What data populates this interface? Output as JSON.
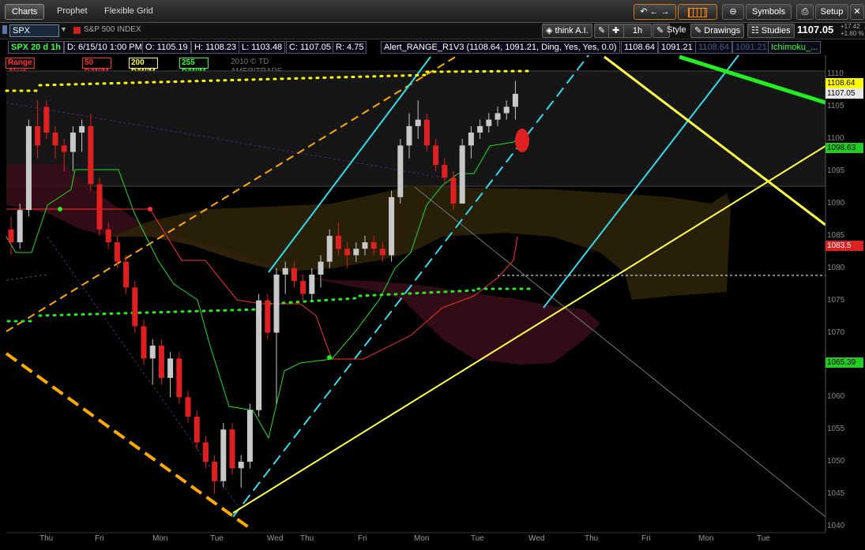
{
  "tabs": [
    {
      "label": "Charts",
      "active": true
    },
    {
      "label": "Prophet",
      "active": false
    },
    {
      "label": "Flexible Grid",
      "active": false
    }
  ],
  "toolbar": {
    "symbols_label": "Symbols",
    "setup_label": "Setup",
    "undo_icon": "undo-icon",
    "back_icon": "back-arrow-icon",
    "forward_icon": "forward-arrow-icon",
    "grid_icon": "grid-layout-icon",
    "minus_icon": "minus-icon",
    "print_icon": "print-icon"
  },
  "symbol_bar": {
    "symbol": "SPX",
    "description": "S&P 500 INDEX",
    "think_ai": "think A.I.",
    "aggregation": "1h",
    "style_label": "Style",
    "drawings_label": "Drawings",
    "studies_label": "Studies",
    "last_price": "1107.05",
    "change": "+17.42",
    "change_pct": "+1.60 %"
  },
  "info_bar": {
    "period": "SPX 20 d 1h",
    "date": "D: 6/15/10 1:00 PM",
    "open": "O: 1105.19",
    "high": "H: 1108.23",
    "low": "L: 1103.48",
    "close": "C: 1107.05",
    "range": "R: 4.75",
    "alert": "Alert_RANGE_R1V3 (1108.64, 1091.21, Ding, Yes, Yes, 0.0)",
    "alert_val1": "1108.64",
    "alert_val2": "1091.21",
    "alert_val3": "1108.64",
    "alert_val4": "1091.21",
    "ichimoku": "Ichimoku_..."
  },
  "legend": {
    "range_alert": "Range Alert ON",
    "ma50": "50 D/W/M",
    "ma200": "200 D/W/M",
    "ma255": "255 D/W/M",
    "copyright": "2010 © TD AMERITRADE IP Company, Inc."
  },
  "colors": {
    "up_candle": "#c8c8c8",
    "down_candle": "#e02020",
    "yellow": "#ffff33",
    "cyan": "#33ddee",
    "green": "#22ee22",
    "orange": "#ffaa00"
  },
  "price_labels": [
    {
      "value": "1108.64",
      "bg": "#ffff00",
      "fg": "#000"
    },
    {
      "value": "1107.05",
      "bg": "#e8e8e8",
      "fg": "#000"
    },
    {
      "value": "1098.63",
      "bg": "#22cc22",
      "fg": "#000"
    },
    {
      "value": "1083.5",
      "bg": "#dd2020",
      "fg": "#fff"
    },
    {
      "value": "1065.39",
      "bg": "#22cc22",
      "fg": "#000"
    }
  ],
  "chart_data": {
    "type": "candlestick",
    "title": "SPX 20 d 1h",
    "ylim": [
      1040,
      1112
    ],
    "y_ticks": [
      1110,
      1105,
      1100,
      1095,
      1090,
      1085,
      1080,
      1075,
      1070,
      1065,
      1060,
      1055,
      1050,
      1045,
      1040
    ],
    "x_ticks": [
      "Thu",
      "Fri",
      "Mon",
      "Tue",
      "Wed",
      "Thu",
      "Fri",
      "Mon",
      "Tue",
      "Wed",
      "Thu",
      "Fri",
      "Mon",
      "Tue"
    ],
    "candles": [
      [
        1086,
        1088,
        1082,
        1084
      ],
      [
        1084,
        1090,
        1083,
        1089
      ],
      [
        1089,
        1103,
        1088,
        1102
      ],
      [
        1102,
        1106,
        1097,
        1099
      ],
      [
        1105,
        1106,
        1100,
        1101
      ],
      [
        1101,
        1102,
        1097,
        1099
      ],
      [
        1099,
        1100,
        1095,
        1098
      ],
      [
        1098,
        1102,
        1095,
        1101
      ],
      [
        1101,
        1103,
        1098,
        1102
      ],
      [
        1102,
        1104,
        1092,
        1093
      ],
      [
        1093,
        1094,
        1085,
        1086
      ],
      [
        1086,
        1087,
        1083,
        1084
      ],
      [
        1084,
        1085,
        1080,
        1081
      ],
      [
        1081,
        1082,
        1076,
        1077
      ],
      [
        1077,
        1078,
        1070,
        1071
      ],
      [
        1071,
        1072,
        1065,
        1066
      ],
      [
        1066,
        1069,
        1062,
        1068
      ],
      [
        1068,
        1069,
        1062,
        1063
      ],
      [
        1063,
        1067,
        1060,
        1066
      ],
      [
        1066,
        1067,
        1059,
        1060
      ],
      [
        1060,
        1061,
        1056,
        1057
      ],
      [
        1057,
        1058,
        1052,
        1053
      ],
      [
        1053,
        1054,
        1049,
        1050
      ],
      [
        1050,
        1051,
        1045,
        1047
      ],
      [
        1047,
        1056,
        1046,
        1055
      ],
      [
        1055,
        1056,
        1048,
        1049
      ],
      [
        1049,
        1051,
        1046,
        1050
      ],
      [
        1050,
        1059,
        1049,
        1058
      ],
      [
        1058,
        1076,
        1057,
        1075
      ],
      [
        1075,
        1076,
        1069,
        1070
      ],
      [
        1070,
        1080,
        1059,
        1079
      ],
      [
        1079,
        1081,
        1076,
        1080
      ],
      [
        1080,
        1081,
        1077,
        1078
      ],
      [
        1078,
        1079,
        1075,
        1076
      ],
      [
        1076,
        1080,
        1075,
        1079
      ],
      [
        1079,
        1082,
        1077,
        1081
      ],
      [
        1081,
        1086,
        1080,
        1085
      ],
      [
        1085,
        1087,
        1082,
        1083
      ],
      [
        1083,
        1084,
        1080,
        1082
      ],
      [
        1082,
        1084,
        1081,
        1083
      ],
      [
        1083,
        1085,
        1082,
        1084
      ],
      [
        1084,
        1085,
        1082,
        1083
      ],
      [
        1083,
        1084,
        1081,
        1082
      ],
      [
        1082,
        1092,
        1081,
        1091
      ],
      [
        1091,
        1100,
        1090,
        1099
      ],
      [
        1099,
        1104,
        1097,
        1102
      ],
      [
        1102,
        1106,
        1100,
        1103
      ],
      [
        1103,
        1104,
        1098,
        1099
      ],
      [
        1099,
        1100,
        1095,
        1096
      ],
      [
        1096,
        1097,
        1093,
        1094
      ],
      [
        1094,
        1095,
        1089,
        1090
      ],
      [
        1090,
        1100,
        1090,
        1099
      ],
      [
        1099,
        1102,
        1097,
        1101
      ],
      [
        1101,
        1103,
        1100,
        1102
      ],
      [
        1102,
        1104,
        1101,
        1103
      ],
      [
        1103,
        1105,
        1102,
        1104
      ],
      [
        1104,
        1106,
        1103,
        1105
      ],
      [
        1105,
        1109,
        1103,
        1107
      ]
    ],
    "alert_high": 1108.64,
    "alert_low": 1091.21,
    "current": 1107.05
  }
}
